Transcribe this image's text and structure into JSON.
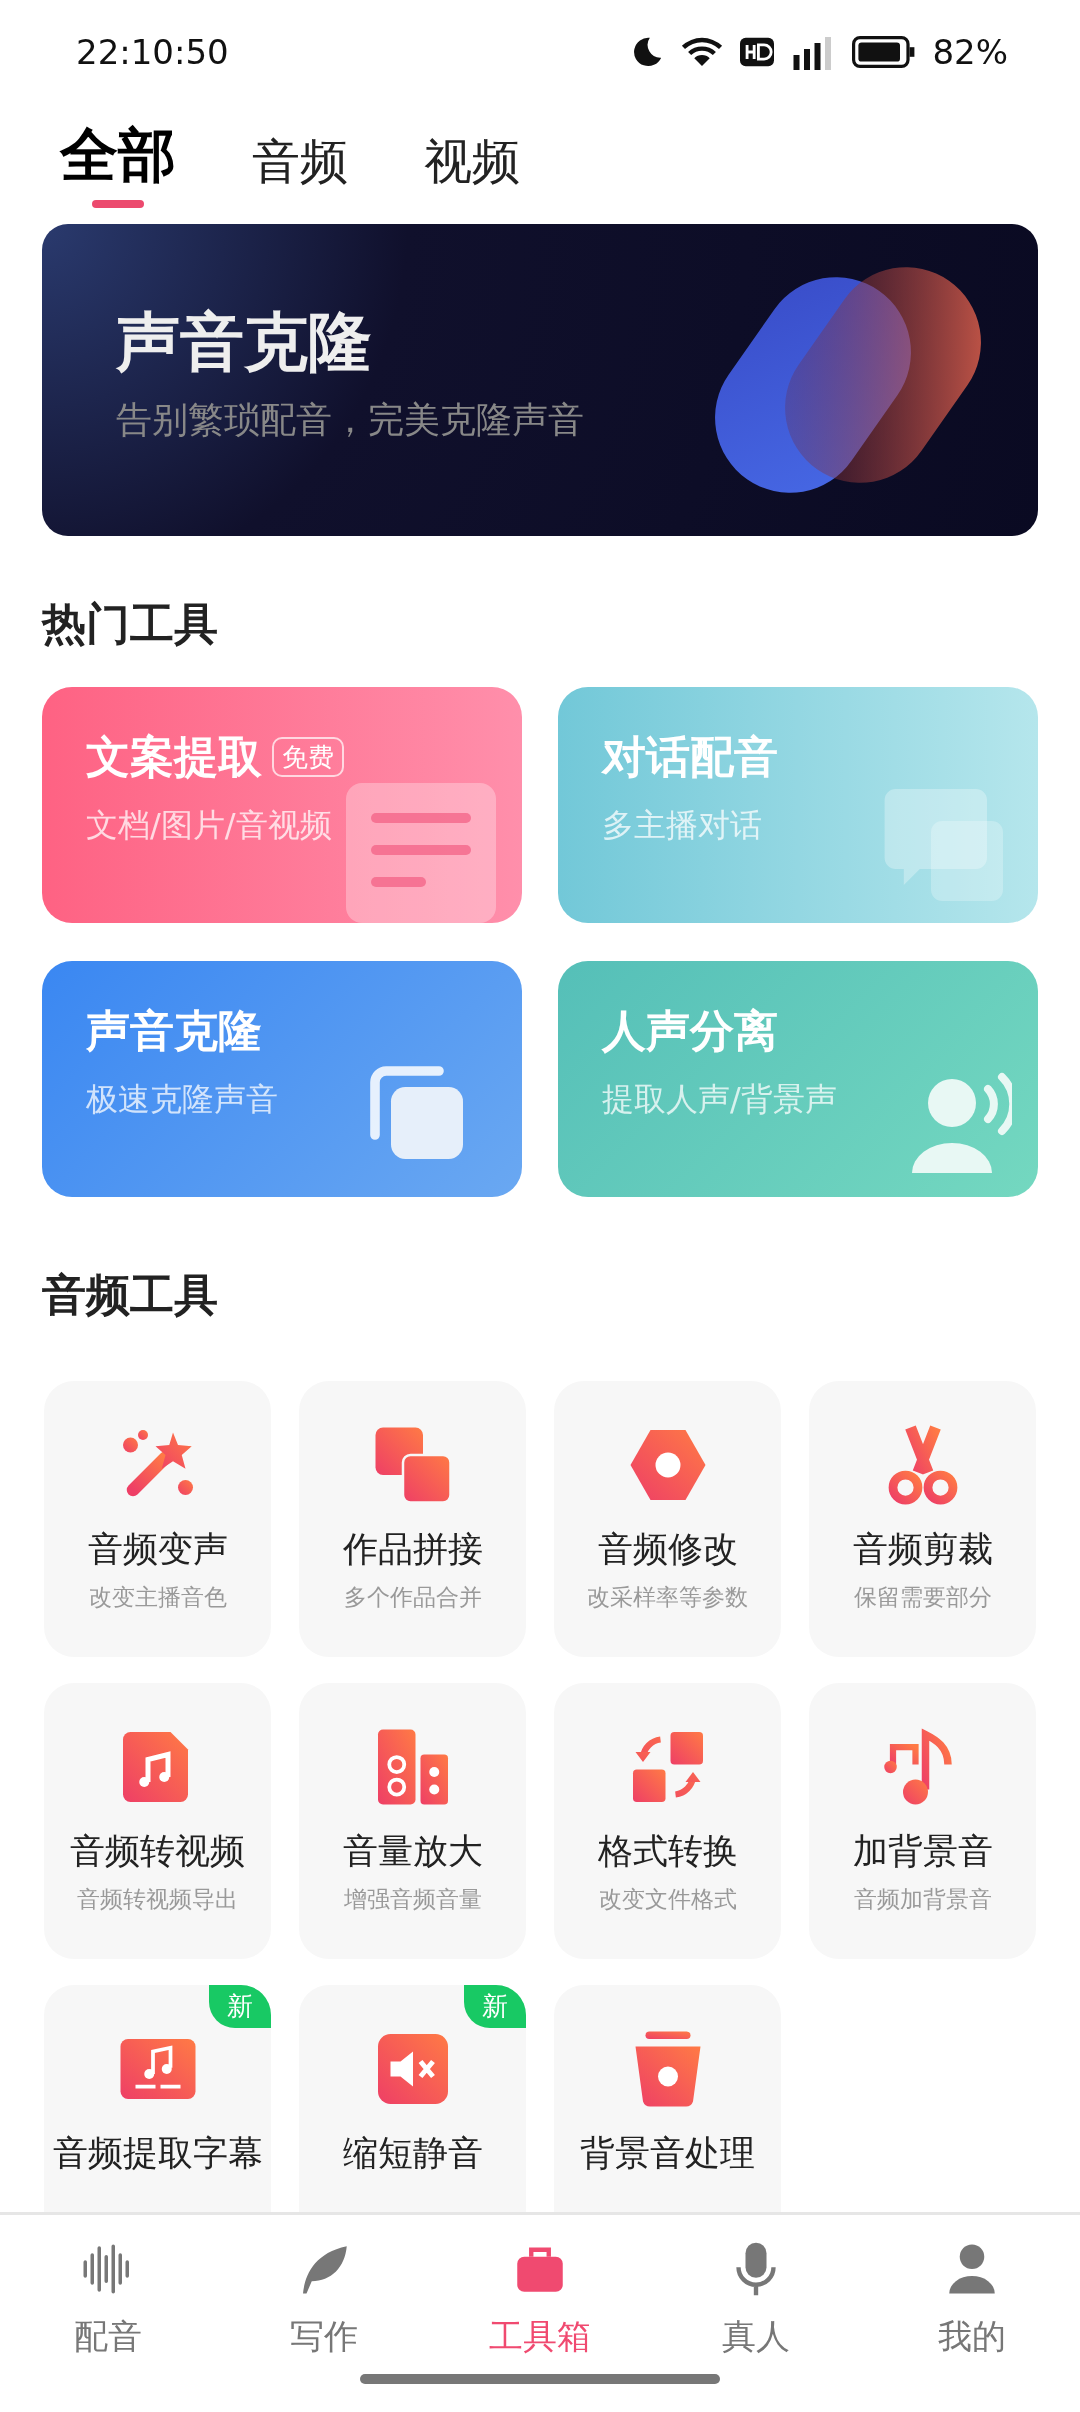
{
  "status_bar": {
    "time": "22:10:50",
    "battery": "82%"
  },
  "tabs": [
    {
      "label": "全部",
      "selected": true
    },
    {
      "label": "音频",
      "selected": false
    },
    {
      "label": "视频",
      "selected": false
    }
  ],
  "banner": {
    "title": "声音克隆",
    "subtitle": "告别繁琐配音，完美克隆声音"
  },
  "hot_tools": {
    "title": "热门工具",
    "items": [
      {
        "kind": "doc",
        "title": "文案提取",
        "badge": "免费",
        "subtitle": "文档/图片/音视频"
      },
      {
        "kind": "chat",
        "title": "对话配音",
        "subtitle": "多主播对话"
      },
      {
        "kind": "clone",
        "title": "声音克隆",
        "subtitle": "极速克隆声音"
      },
      {
        "kind": "voice",
        "title": "人声分离",
        "subtitle": "提取人声/背景声"
      }
    ]
  },
  "audio_tools": {
    "title": "音频工具",
    "items": [
      {
        "kind": "wand",
        "name": "音频变声",
        "desc": "改变主播音色"
      },
      {
        "kind": "squares",
        "name": "作品拼接",
        "desc": "多个作品合并"
      },
      {
        "kind": "hexagon",
        "name": "音频修改",
        "desc": "改采样率等参数"
      },
      {
        "kind": "scissors",
        "name": "音频剪裁",
        "desc": "保留需要部分"
      },
      {
        "kind": "musicfile",
        "name": "音频转视频",
        "desc": "音频转视频导出"
      },
      {
        "kind": "speaker",
        "name": "音量放大",
        "desc": "增强音频音量"
      },
      {
        "kind": "convert",
        "name": "格式转换",
        "desc": "改变文件格式"
      },
      {
        "kind": "notes",
        "name": "加背景音",
        "desc": "音频加背景音"
      },
      {
        "kind": "subtitle",
        "name": "音频提取字幕",
        "badge": "新"
      },
      {
        "kind": "mute",
        "name": "缩短静音",
        "badge": "新"
      },
      {
        "kind": "bucket",
        "name": "背景音处理"
      }
    ]
  },
  "bottom_nav": [
    {
      "kind": "wave",
      "label": "配音",
      "selected": false
    },
    {
      "kind": "feather",
      "label": "写作",
      "selected": false
    },
    {
      "kind": "toolbox",
      "label": "工具箱",
      "selected": true
    },
    {
      "kind": "mic",
      "label": "真人",
      "selected": false
    },
    {
      "kind": "person",
      "label": "我的",
      "selected": false
    }
  ]
}
